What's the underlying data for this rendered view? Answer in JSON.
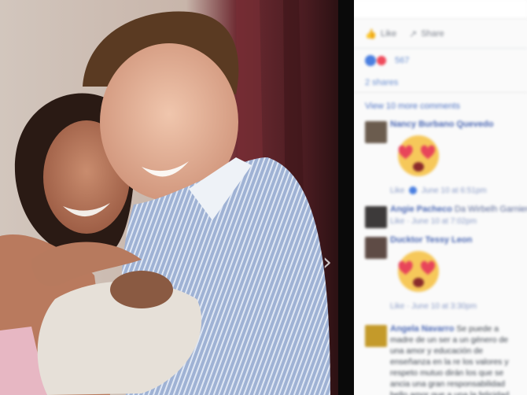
{
  "viewer": {
    "next_arrow": "›"
  },
  "panel": {
    "actions": [
      {
        "label": "Like",
        "icon": "thumbs-up-icon"
      },
      {
        "label": "Share",
        "icon": "share-icon"
      }
    ],
    "reaction_count": "567",
    "shares": "2 shares",
    "view_more": "View 10 more comments",
    "comments": [
      {
        "author": "Nancy Burbano Quevedo",
        "text": "",
        "meta_like": "Like",
        "meta_time": "June 10 at 6:51pm",
        "emoji": "heart-eyes-emoji",
        "avatar_color": "#6b5c4e"
      },
      {
        "author": "Angie Pacheco",
        "text": "Da Wirbelh Garnier",
        "meta_like": "Like",
        "meta_time": "June 10 at 7:02pm",
        "emoji": "",
        "avatar_color": "#3d3a3a"
      },
      {
        "author": "Ducktor Tessy Leon",
        "text": "",
        "meta_like": "Like",
        "meta_time": "June 10 at 3:30pm",
        "emoji": "heart-eyes-emoji",
        "avatar_color": "#5e4b45"
      },
      {
        "author": "Angela Navarro",
        "text": "Se puede a madre de un ser a un género de una amor y educación de enseñanza en la re los valores y respeto mutuo dirán los que se ancia una gran responsabilidad bello amor que a una la felicidad es",
        "meta_like": "",
        "meta_time": "",
        "emoji": "",
        "avatar_color": "#c49a2a"
      }
    ]
  },
  "colors": {
    "link": "#4a67b3",
    "love": "#ef4b5c",
    "like": "#4a7fe0"
  }
}
